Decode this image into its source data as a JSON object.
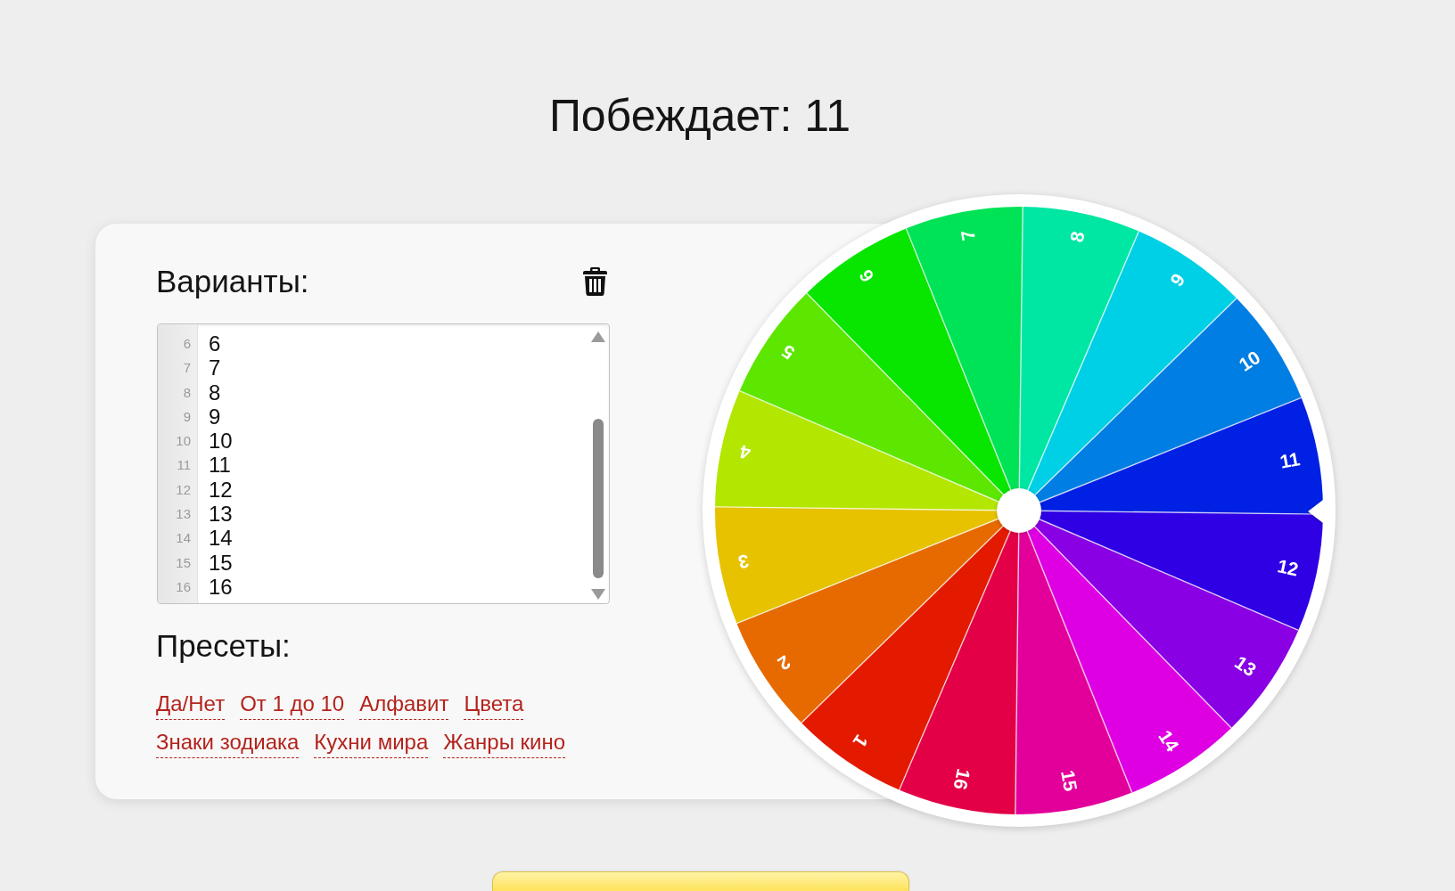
{
  "winner": {
    "text": "Побеждает: 11"
  },
  "options": {
    "title": "Варианты:",
    "lines": [
      {
        "number": "6",
        "text": "6"
      },
      {
        "number": "7",
        "text": "7"
      },
      {
        "number": "8",
        "text": "8"
      },
      {
        "number": "9",
        "text": "9"
      },
      {
        "number": "10",
        "text": "10"
      },
      {
        "number": "11",
        "text": "11"
      },
      {
        "number": "12",
        "text": "12"
      },
      {
        "number": "13",
        "text": "13"
      },
      {
        "number": "14",
        "text": "14"
      },
      {
        "number": "15",
        "text": "15"
      },
      {
        "number": "16",
        "text": "16"
      }
    ]
  },
  "presets": {
    "title": "Пресеты:",
    "links": [
      "Да/Нет",
      "От 1 до 10",
      "Алфавит",
      "Цвета",
      "Знаки зодиака",
      "Кухни мира",
      "Жанры кино"
    ]
  },
  "wheel": {
    "segments": [
      {
        "label": "1",
        "color": "#e41a00"
      },
      {
        "label": "2",
        "color": "#e66a00"
      },
      {
        "label": "3",
        "color": "#e6c200"
      },
      {
        "label": "4",
        "color": "#b3e600"
      },
      {
        "label": "5",
        "color": "#5de600"
      },
      {
        "label": "6",
        "color": "#08e600"
      },
      {
        "label": "7",
        "color": "#00e356"
      },
      {
        "label": "8",
        "color": "#00e6a3"
      },
      {
        "label": "9",
        "color": "#00d0e6"
      },
      {
        "label": "10",
        "color": "#007ee3"
      },
      {
        "label": "11",
        "color": "#0020e3"
      },
      {
        "label": "12",
        "color": "#2e00e3"
      },
      {
        "label": "13",
        "color": "#8800e3"
      },
      {
        "label": "14",
        "color": "#de00e3"
      },
      {
        "label": "15",
        "color": "#e3009a"
      },
      {
        "label": "16",
        "color": "#e30046"
      }
    ]
  }
}
